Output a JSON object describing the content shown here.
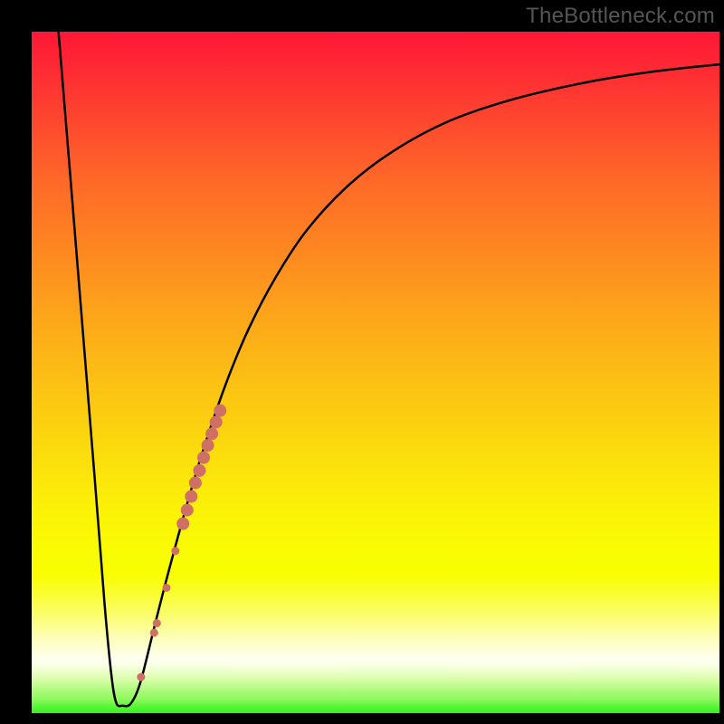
{
  "watermark": "TheBottleneck.com",
  "chart_data": {
    "type": "line",
    "title": "",
    "xlabel": "",
    "ylabel": "",
    "xlim": [
      0,
      100
    ],
    "ylim": [
      0,
      100
    ],
    "grid": false,
    "legend": false,
    "gradient_colors": {
      "top": "#fe1736",
      "mid1": "#fd9a1d",
      "mid2": "#fbf108",
      "mid3": "#feffef",
      "bottom": "#32f31a"
    },
    "curve_stroke": "#000000",
    "curve_points": [
      {
        "x": 3.9,
        "y": 100.0
      },
      {
        "x": 5.6,
        "y": 79.0
      },
      {
        "x": 7.4,
        "y": 56.5
      },
      {
        "x": 9.2,
        "y": 34.0
      },
      {
        "x": 10.6,
        "y": 16.0
      },
      {
        "x": 11.6,
        "y": 5.5
      },
      {
        "x": 12.3,
        "y": 1.5
      },
      {
        "x": 13.2,
        "y": 1.1
      },
      {
        "x": 14.4,
        "y": 1.4
      },
      {
        "x": 15.8,
        "y": 4.5
      },
      {
        "x": 17.8,
        "y": 12.5
      },
      {
        "x": 19.7,
        "y": 20.0
      },
      {
        "x": 22.4,
        "y": 30.0
      },
      {
        "x": 25.0,
        "y": 38.8
      },
      {
        "x": 28.3,
        "y": 48.5
      },
      {
        "x": 31.6,
        "y": 56.5
      },
      {
        "x": 35.5,
        "y": 64.0
      },
      {
        "x": 40.1,
        "y": 71.0
      },
      {
        "x": 46.1,
        "y": 77.5
      },
      {
        "x": 52.6,
        "y": 82.5
      },
      {
        "x": 60.5,
        "y": 86.8
      },
      {
        "x": 69.7,
        "y": 90.0
      },
      {
        "x": 80.3,
        "y": 92.5
      },
      {
        "x": 90.8,
        "y": 94.2
      },
      {
        "x": 100.0,
        "y": 95.2
      }
    ],
    "marker_color": "#cf6f65",
    "markers": [
      {
        "x": 15.9,
        "y": 5.3,
        "r": 4.5
      },
      {
        "x": 17.8,
        "y": 11.8,
        "r": 4.5
      },
      {
        "x": 18.2,
        "y": 13.2,
        "r": 4.5
      },
      {
        "x": 19.6,
        "y": 18.4,
        "r": 4.5
      },
      {
        "x": 20.9,
        "y": 23.8,
        "r": 4.5
      },
      {
        "x": 22.0,
        "y": 27.8,
        "r": 7.0
      },
      {
        "x": 22.6,
        "y": 29.8,
        "r": 7.0
      },
      {
        "x": 23.2,
        "y": 31.8,
        "r": 7.0
      },
      {
        "x": 23.8,
        "y": 33.8,
        "r": 7.0
      },
      {
        "x": 24.4,
        "y": 35.6,
        "r": 7.0
      },
      {
        "x": 25.0,
        "y": 37.5,
        "r": 7.0
      },
      {
        "x": 25.6,
        "y": 39.3,
        "r": 7.0
      },
      {
        "x": 26.2,
        "y": 41.0,
        "r": 7.0
      },
      {
        "x": 26.8,
        "y": 42.7,
        "r": 7.0
      },
      {
        "x": 27.4,
        "y": 44.4,
        "r": 7.0
      }
    ]
  }
}
